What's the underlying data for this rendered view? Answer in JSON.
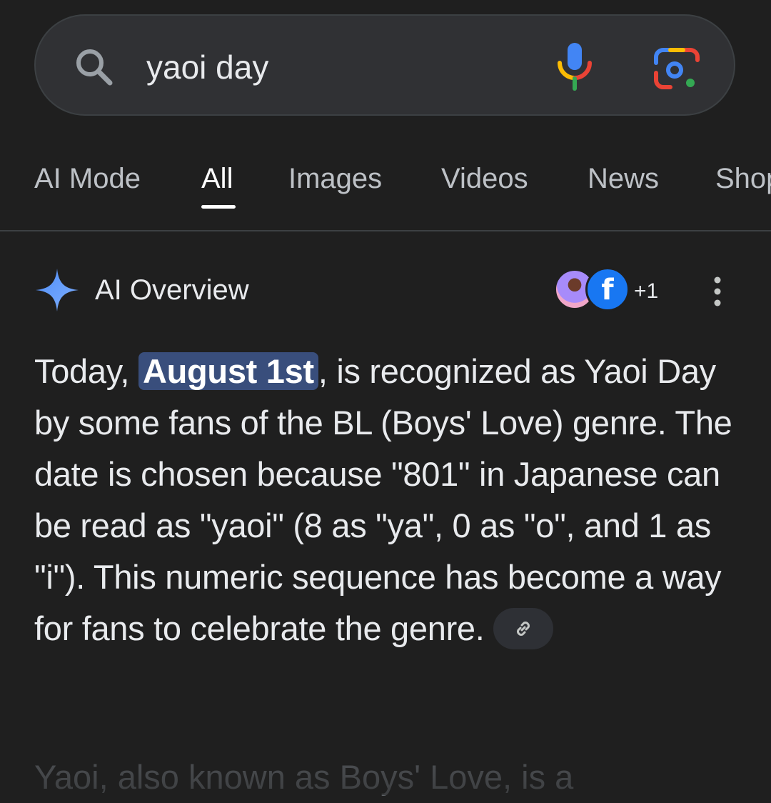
{
  "search": {
    "query": "yaoi day",
    "icon": "search-icon",
    "mic_icon": "mic-icon",
    "lens_icon": "lens-icon"
  },
  "tabs": [
    {
      "label": "AI Mode",
      "active": false
    },
    {
      "label": "All",
      "active": true
    },
    {
      "label": "Images",
      "active": false
    },
    {
      "label": "Videos",
      "active": false
    },
    {
      "label": "News",
      "active": false
    },
    {
      "label": "Shop",
      "active": false
    }
  ],
  "overview": {
    "title": "AI Overview",
    "source_count": "+1",
    "icon": "sparkle-icon",
    "paragraph": {
      "pre": "Today, ",
      "highlight": "August 1st",
      "post": ", is recognized as Yaoi Day by some fans of the BL (Boys' Love) genre. The date is chosen because \"801\" in Japanese can be read as \"yaoi\" (8 as \"ya\", 0 as \"o\", and 1 as \"i\"). This numeric sequence has become a way for fans to celebrate the genre."
    },
    "next_paragraph": "Yaoi, also known as Boys' Love, is a"
  },
  "colors": {
    "background": "#1f1f1f",
    "search_bg": "#303134",
    "highlight": "#394e7c",
    "facebook": "#1877f2"
  }
}
